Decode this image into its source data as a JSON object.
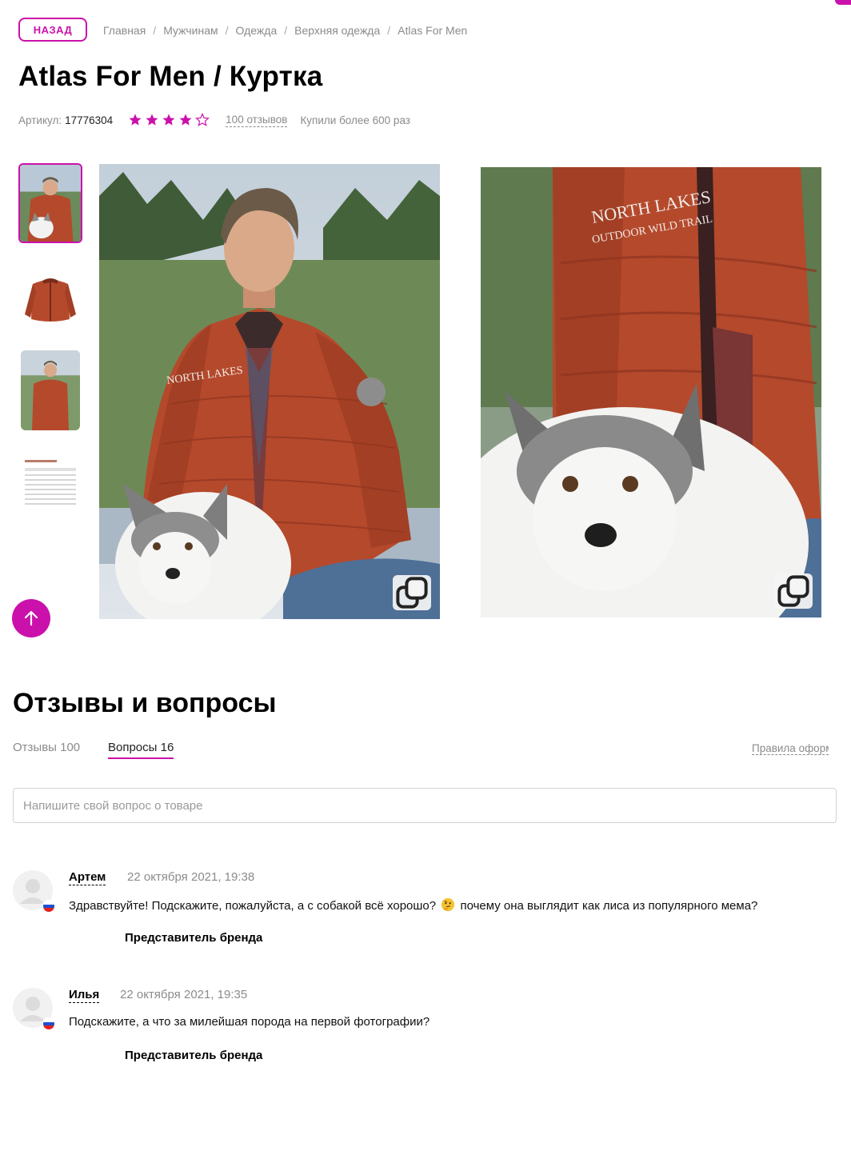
{
  "header": {
    "back_label": "НАЗАД",
    "breadcrumb": [
      "Главная",
      "Мужчинам",
      "Одежда",
      "Верхняя одежда",
      "Atlas For Men"
    ],
    "separator": "/"
  },
  "product": {
    "title": "Atlas For Men / Куртка",
    "article_label": "Артикул:",
    "article_value": "17776304",
    "rating": 4,
    "rating_max": 5,
    "reviews_link": "100 отзывов",
    "bought_text": "Купили более 600 раз"
  },
  "gallery": {
    "thumbnails": [
      "thumb-photo-man-dog",
      "thumb-photo-jacket",
      "thumb-photo-man-standing",
      "thumb-size-chart"
    ],
    "active_index": 0,
    "copy_icon": "copy-icon",
    "accent_color": "#cb11ab",
    "jacket_color": "#b5492c"
  },
  "qa": {
    "title": "Отзывы и вопросы",
    "tab_reviews": "Отзывы 100",
    "tab_questions": "Вопросы 16",
    "rules_link": "Правила оформления",
    "input_placeholder": "Напишите свой вопрос о товаре",
    "questions": [
      {
        "author": "Артем",
        "date": "22 октября 2021, 19:38",
        "text_before": "Здравствуйте! Подскажите, пожалуйста, а с собакой всё хорошо?",
        "emoji": "thinking-face-emoji",
        "text_after": "почему она выглядит как лиса из популярного мема?",
        "answer_label": "Представитель бренда"
      },
      {
        "author": "Илья",
        "date": "22 октября 2021, 19:35",
        "text": "Подскажите, а что за милейшая порода на первой фотографии?",
        "answer_label": "Представитель бренда"
      }
    ]
  }
}
